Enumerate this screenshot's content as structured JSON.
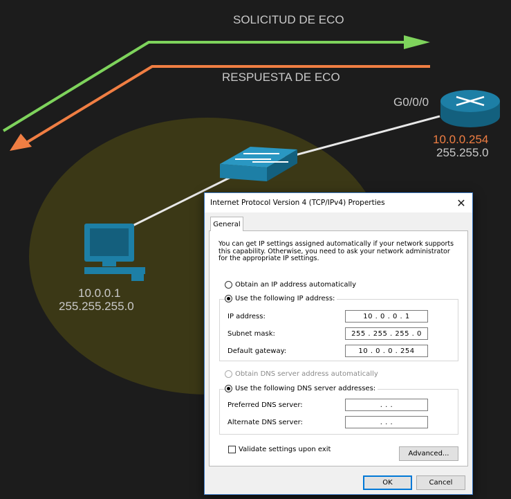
{
  "diagram": {
    "echo_request_label": "SOLICITUD DE ECO",
    "echo_reply_label": "RESPUESTA DE ECO",
    "router_interface": "G0/0/0",
    "router_ip": "10.0.0.254",
    "router_mask": "255.255.0",
    "pc_ip": "10.0.0.1",
    "pc_mask": "255.255.255.0",
    "colors": {
      "request_arrow": "#7ed35c",
      "reply_arrow": "#f07e43",
      "ellipse": "#3b3816",
      "device_blue": "#1d7fa6",
      "router_ip_text": "#f07e43",
      "label_text": "#c9c9c9"
    }
  },
  "dialog": {
    "title": "Internet Protocol Version 4 (TCP/IPv4) Properties",
    "close_glyph": "✕",
    "tab_general": "General",
    "description": "You can get IP settings assigned automatically if your network supports this capability. Otherwise, you need to ask your network administrator for the appropriate IP settings.",
    "obtain_ip_auto": "Obtain an IP address automatically",
    "use_following_ip": "Use the following IP address:",
    "ip_address_label": "IP address:",
    "ip_address_value": "10  .  0  .  0  .  1",
    "subnet_mask_label": "Subnet mask:",
    "subnet_mask_value": "255 . 255 . 255 .  0",
    "default_gateway_label": "Default gateway:",
    "default_gateway_value": "10  .  0  .  0  . 254",
    "obtain_dns_auto": "Obtain DNS server address automatically",
    "use_following_dns": "Use the following DNS server addresses:",
    "preferred_dns_label": "Preferred DNS server:",
    "preferred_dns_value": ".      .      .",
    "alternate_dns_label": "Alternate DNS server:",
    "alternate_dns_value": ".      .      .",
    "validate_label": "Validate settings upon exit",
    "advanced_button": "Advanced...",
    "ok_button": "OK",
    "cancel_button": "Cancel"
  }
}
